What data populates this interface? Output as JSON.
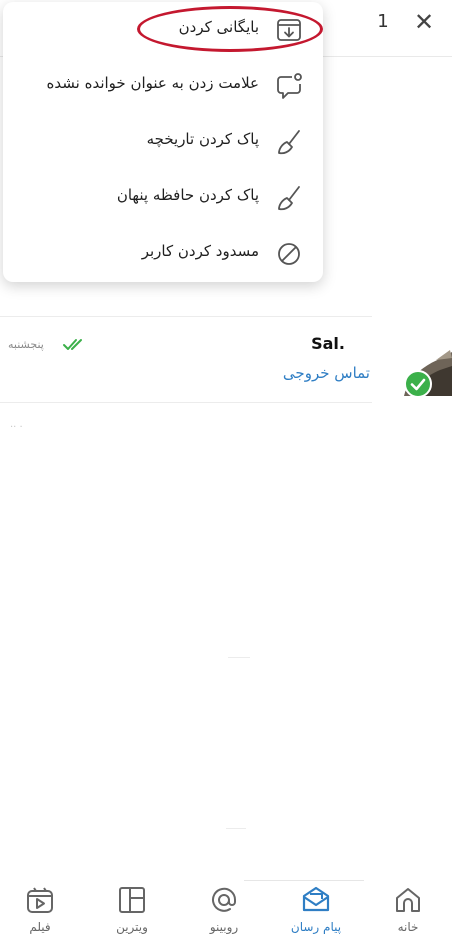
{
  "header": {
    "selected_count": "1",
    "close_label": "✕"
  },
  "menu": {
    "items": [
      {
        "label": "بایگانی کردن",
        "icon": "archive-icon"
      },
      {
        "label": "علامت زدن به عنوان خوانده نشده",
        "icon": "unread-chat-icon"
      },
      {
        "label": "پاک کردن تاریخچه",
        "icon": "broom-icon"
      },
      {
        "label": "پاک کردن حافظه پنهان",
        "icon": "broom-icon"
      },
      {
        "label": "مسدود کردن کاربر",
        "icon": "block-icon"
      }
    ],
    "highlighted_item_index": 0,
    "highlight_color": "#c4182f"
  },
  "chat": {
    "name": "Sal.",
    "subtitle": "تماس خروجی",
    "time": "پنجشنبه",
    "ticks": "double-check-icon",
    "tick_color": "#3bb04a",
    "subtitle_color": "#2f7ec4"
  },
  "nav": {
    "items": [
      {
        "label": "خانه",
        "icon": "home-icon",
        "active": false
      },
      {
        "label": "پیام رسان",
        "icon": "mail-icon",
        "active": true
      },
      {
        "label": "روبینو",
        "icon": "at-icon",
        "active": false
      },
      {
        "label": "ویترین",
        "icon": "grid-icon",
        "active": false
      },
      {
        "label": "فیلم",
        "icon": "video-icon",
        "active": false
      }
    ],
    "active_color": "#2f7ec4"
  },
  "colors": {
    "accent": "#2f7ec4",
    "online_badge": "#3bb04a"
  }
}
